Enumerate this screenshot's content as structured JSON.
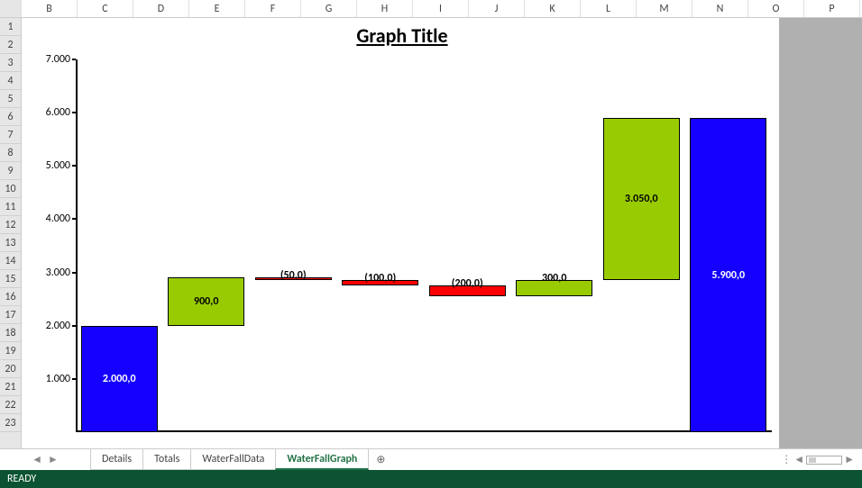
{
  "columns": [
    "B",
    "C",
    "D",
    "E",
    "F",
    "G",
    "H",
    "I",
    "J",
    "K",
    "L",
    "M",
    "N",
    "O",
    "P"
  ],
  "rows": [
    "1",
    "2",
    "3",
    "4",
    "5",
    "6",
    "7",
    "8",
    "9",
    "10",
    "11",
    "12",
    "13",
    "14",
    "15",
    "16",
    "17",
    "18",
    "19",
    "20",
    "21",
    "22",
    "23"
  ],
  "tabs": {
    "items": [
      "Details",
      "Totals",
      "WaterFallData",
      "WaterFallGraph"
    ],
    "active": "WaterFallGraph"
  },
  "status": {
    "text": "READY"
  },
  "chart_title": "Graph Title",
  "y_ticks": [
    "1.000",
    "2.000",
    "3.000",
    "4.000",
    "5.000",
    "6.000",
    "7.000"
  ],
  "chart_data": {
    "type": "bar",
    "title": "Graph Title",
    "xlabel": "",
    "ylabel": "",
    "ylim": [
      0,
      7000
    ],
    "subtype": "waterfall",
    "bars": [
      {
        "kind": "total",
        "label": "2.000,0",
        "base": 0,
        "value": 2000,
        "top": 2000,
        "color": "#1500FF",
        "text_color": "#fff",
        "label_pos": "middle"
      },
      {
        "kind": "increase",
        "label": "900,0",
        "base": 2000,
        "value": 900,
        "top": 2900,
        "color": "#99CC00",
        "text_color": "#000",
        "label_pos": "middle"
      },
      {
        "kind": "decrease",
        "label": "(50,0)",
        "base": 2900,
        "value": -50,
        "top": 2850,
        "color": "#FF0000",
        "text_color": "#000",
        "label_pos": "above"
      },
      {
        "kind": "decrease",
        "label": "(100,0)",
        "base": 2850,
        "value": -100,
        "top": 2750,
        "color": "#FF0000",
        "text_color": "#000",
        "label_pos": "above"
      },
      {
        "kind": "decrease",
        "label": "(200,0)",
        "base": 2750,
        "value": -200,
        "top": 2550,
        "color": "#FF0000",
        "text_color": "#000",
        "label_pos": "above"
      },
      {
        "kind": "increase",
        "label": "300,0",
        "base": 2550,
        "value": 300,
        "top": 2850,
        "color": "#99CC00",
        "text_color": "#000",
        "label_pos": "above"
      },
      {
        "kind": "increase",
        "label": "3.050,0",
        "base": 2850,
        "value": 3050,
        "top": 5900,
        "color": "#99CC00",
        "text_color": "#000",
        "label_pos": "middle"
      },
      {
        "kind": "total",
        "label": "5.900,0",
        "base": 0,
        "value": 5900,
        "top": 5900,
        "color": "#1500FF",
        "text_color": "#fff",
        "label_pos": "middle"
      }
    ]
  }
}
